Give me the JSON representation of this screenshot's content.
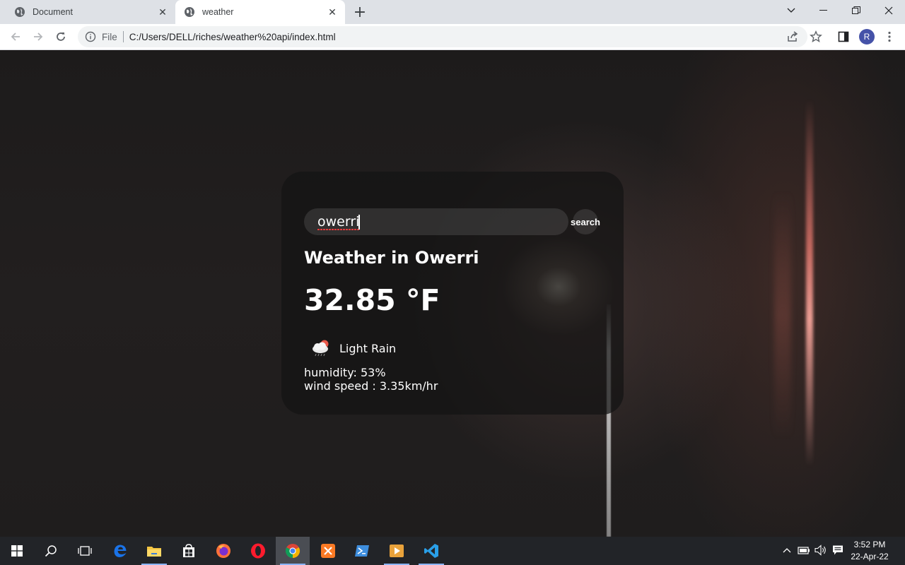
{
  "browser": {
    "tabs": [
      {
        "title": "Document",
        "icon": "globe-icon",
        "active": false
      },
      {
        "title": "weather",
        "icon": "globe-icon",
        "active": true
      }
    ],
    "address": {
      "scheme_label": "File",
      "url": "C:/Users/DELL/riches/weather%20api/index.html"
    },
    "profile_initial": "R"
  },
  "weather_app": {
    "search": {
      "value": "owerri",
      "placeholder": "",
      "button_label": "search"
    },
    "city_heading": "Weather in Owerri",
    "temperature": "32.85 °F",
    "condition": {
      "icon": "cloud-rain-sun-icon",
      "text": "Light Rain"
    },
    "humidity": "humidity: 53%",
    "wind_speed": "wind speed : 3.35km/hr"
  },
  "taskbar": {
    "apps": [
      "start",
      "search",
      "task-view",
      "edge",
      "file-explorer",
      "store",
      "firefox",
      "opera",
      "chrome",
      "xampp",
      "powershell",
      "media-player",
      "vscode"
    ],
    "clock": {
      "time": "3:52 PM",
      "date": "22-Apr-22"
    }
  },
  "colors": {
    "accent": "#8ab4f8",
    "card_bg": "#141414",
    "text": "#ffffff",
    "spell_underline": "#e03a3a"
  }
}
